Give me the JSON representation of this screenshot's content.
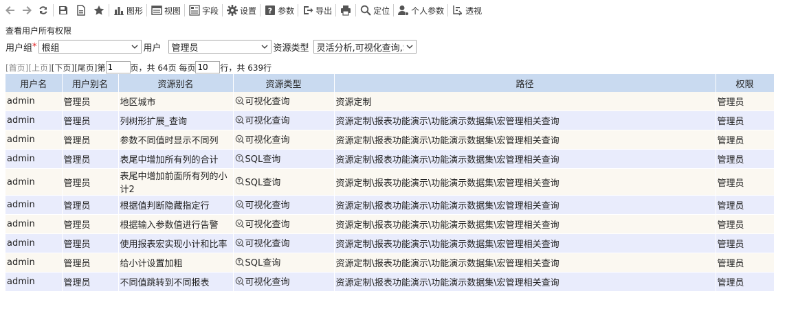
{
  "toolbar": {
    "back_icon": "arrow-left-icon",
    "forward_icon": "arrow-right-icon",
    "refresh_icon": "refresh-icon",
    "save_icon": "save-icon",
    "save_as_icon": "save-as-icon",
    "favorite_icon": "star-icon",
    "chart_label": "图形",
    "view_label": "视图",
    "field_label": "字段",
    "settings_label": "设置",
    "params_label": "参数",
    "export_label": "导出",
    "print_icon": "print-icon",
    "locate_label": "定位",
    "personal_params_label": "个人参数",
    "pivot_label": "透视"
  },
  "page_title": "查看用户所有权限",
  "filters": {
    "user_group_label": "用户组",
    "required_mark": "*",
    "user_group_value": "根组",
    "user_label": "用户",
    "user_value": "管理员",
    "resource_type_label": "资源类型",
    "resource_type_value": "灵活分析,可视化查询,S"
  },
  "pager": {
    "first": "[首页]",
    "prev": "[上页]",
    "next": "[下页]",
    "last": "[尾页]",
    "page_prefix": " 第",
    "current_page": "1",
    "page_suffix": " 页，共 64页 每页",
    "page_size": "10",
    "rows_suffix": " 行，共 639行"
  },
  "table": {
    "headers": [
      "用户名",
      "用户别名",
      "资源别名",
      "资源类型",
      "路径",
      "权限"
    ],
    "rows": [
      {
        "user": "admin",
        "alias": "管理员",
        "resource": "地区城市",
        "type": "可视化查询",
        "type_icon": "visual-query-icon",
        "path": "资源定制",
        "perm": "管理员"
      },
      {
        "user": "admin",
        "alias": "管理员",
        "resource": "列树形扩展_查询",
        "type": "可视化查询",
        "type_icon": "visual-query-icon",
        "path": "资源定制\\报表功能演示\\功能演示数据集\\宏管理相关查询",
        "perm": "管理员"
      },
      {
        "user": "admin",
        "alias": "管理员",
        "resource": "参数不同值时显示不同列",
        "type": "可视化查询",
        "type_icon": "visual-query-icon",
        "path": "资源定制\\报表功能演示\\功能演示数据集\\宏管理相关查询",
        "perm": "管理员"
      },
      {
        "user": "admin",
        "alias": "管理员",
        "resource": "表尾中增加所有列的合计",
        "type": "SQL查询",
        "type_icon": "sql-query-icon",
        "path": "资源定制\\报表功能演示\\功能演示数据集\\宏管理相关查询",
        "perm": "管理员"
      },
      {
        "user": "admin",
        "alias": "管理员",
        "resource": "表尾中增加前面所有列的小计2",
        "type": "SQL查询",
        "type_icon": "sql-query-icon",
        "path": "资源定制\\报表功能演示\\功能演示数据集\\宏管理相关查询",
        "perm": "管理员"
      },
      {
        "user": "admin",
        "alias": "管理员",
        "resource": "根据值判断隐藏指定行",
        "type": "可视化查询",
        "type_icon": "visual-query-icon",
        "path": "资源定制\\报表功能演示\\功能演示数据集\\宏管理相关查询",
        "perm": "管理员"
      },
      {
        "user": "admin",
        "alias": "管理员",
        "resource": "根据输入参数值进行告警",
        "type": "可视化查询",
        "type_icon": "visual-query-icon",
        "path": "资源定制\\报表功能演示\\功能演示数据集\\宏管理相关查询",
        "perm": "管理员"
      },
      {
        "user": "admin",
        "alias": "管理员",
        "resource": "使用报表宏实现小计和比率",
        "type": "可视化查询",
        "type_icon": "visual-query-icon",
        "path": "资源定制\\报表功能演示\\功能演示数据集\\宏管理相关查询",
        "perm": "管理员"
      },
      {
        "user": "admin",
        "alias": "管理员",
        "resource": "给小计设置加粗",
        "type": "SQL查询",
        "type_icon": "sql-query-icon",
        "path": "资源定制\\报表功能演示\\功能演示数据集\\宏管理相关查询",
        "perm": "管理员"
      },
      {
        "user": "admin",
        "alias": "管理员",
        "resource": "不同值跳转到不同报表",
        "type": "可视化查询",
        "type_icon": "visual-query-icon",
        "path": "资源定制\\报表功能演示\\功能演示数据集\\宏管理相关查询",
        "perm": "管理员"
      }
    ]
  },
  "colors": {
    "header_bg": "#c9daf0",
    "row_odd_bg": "#fbf8f1",
    "row_even_bg": "#e9ecfc",
    "required": "#e02020",
    "toolbar_icon": "#555555"
  }
}
